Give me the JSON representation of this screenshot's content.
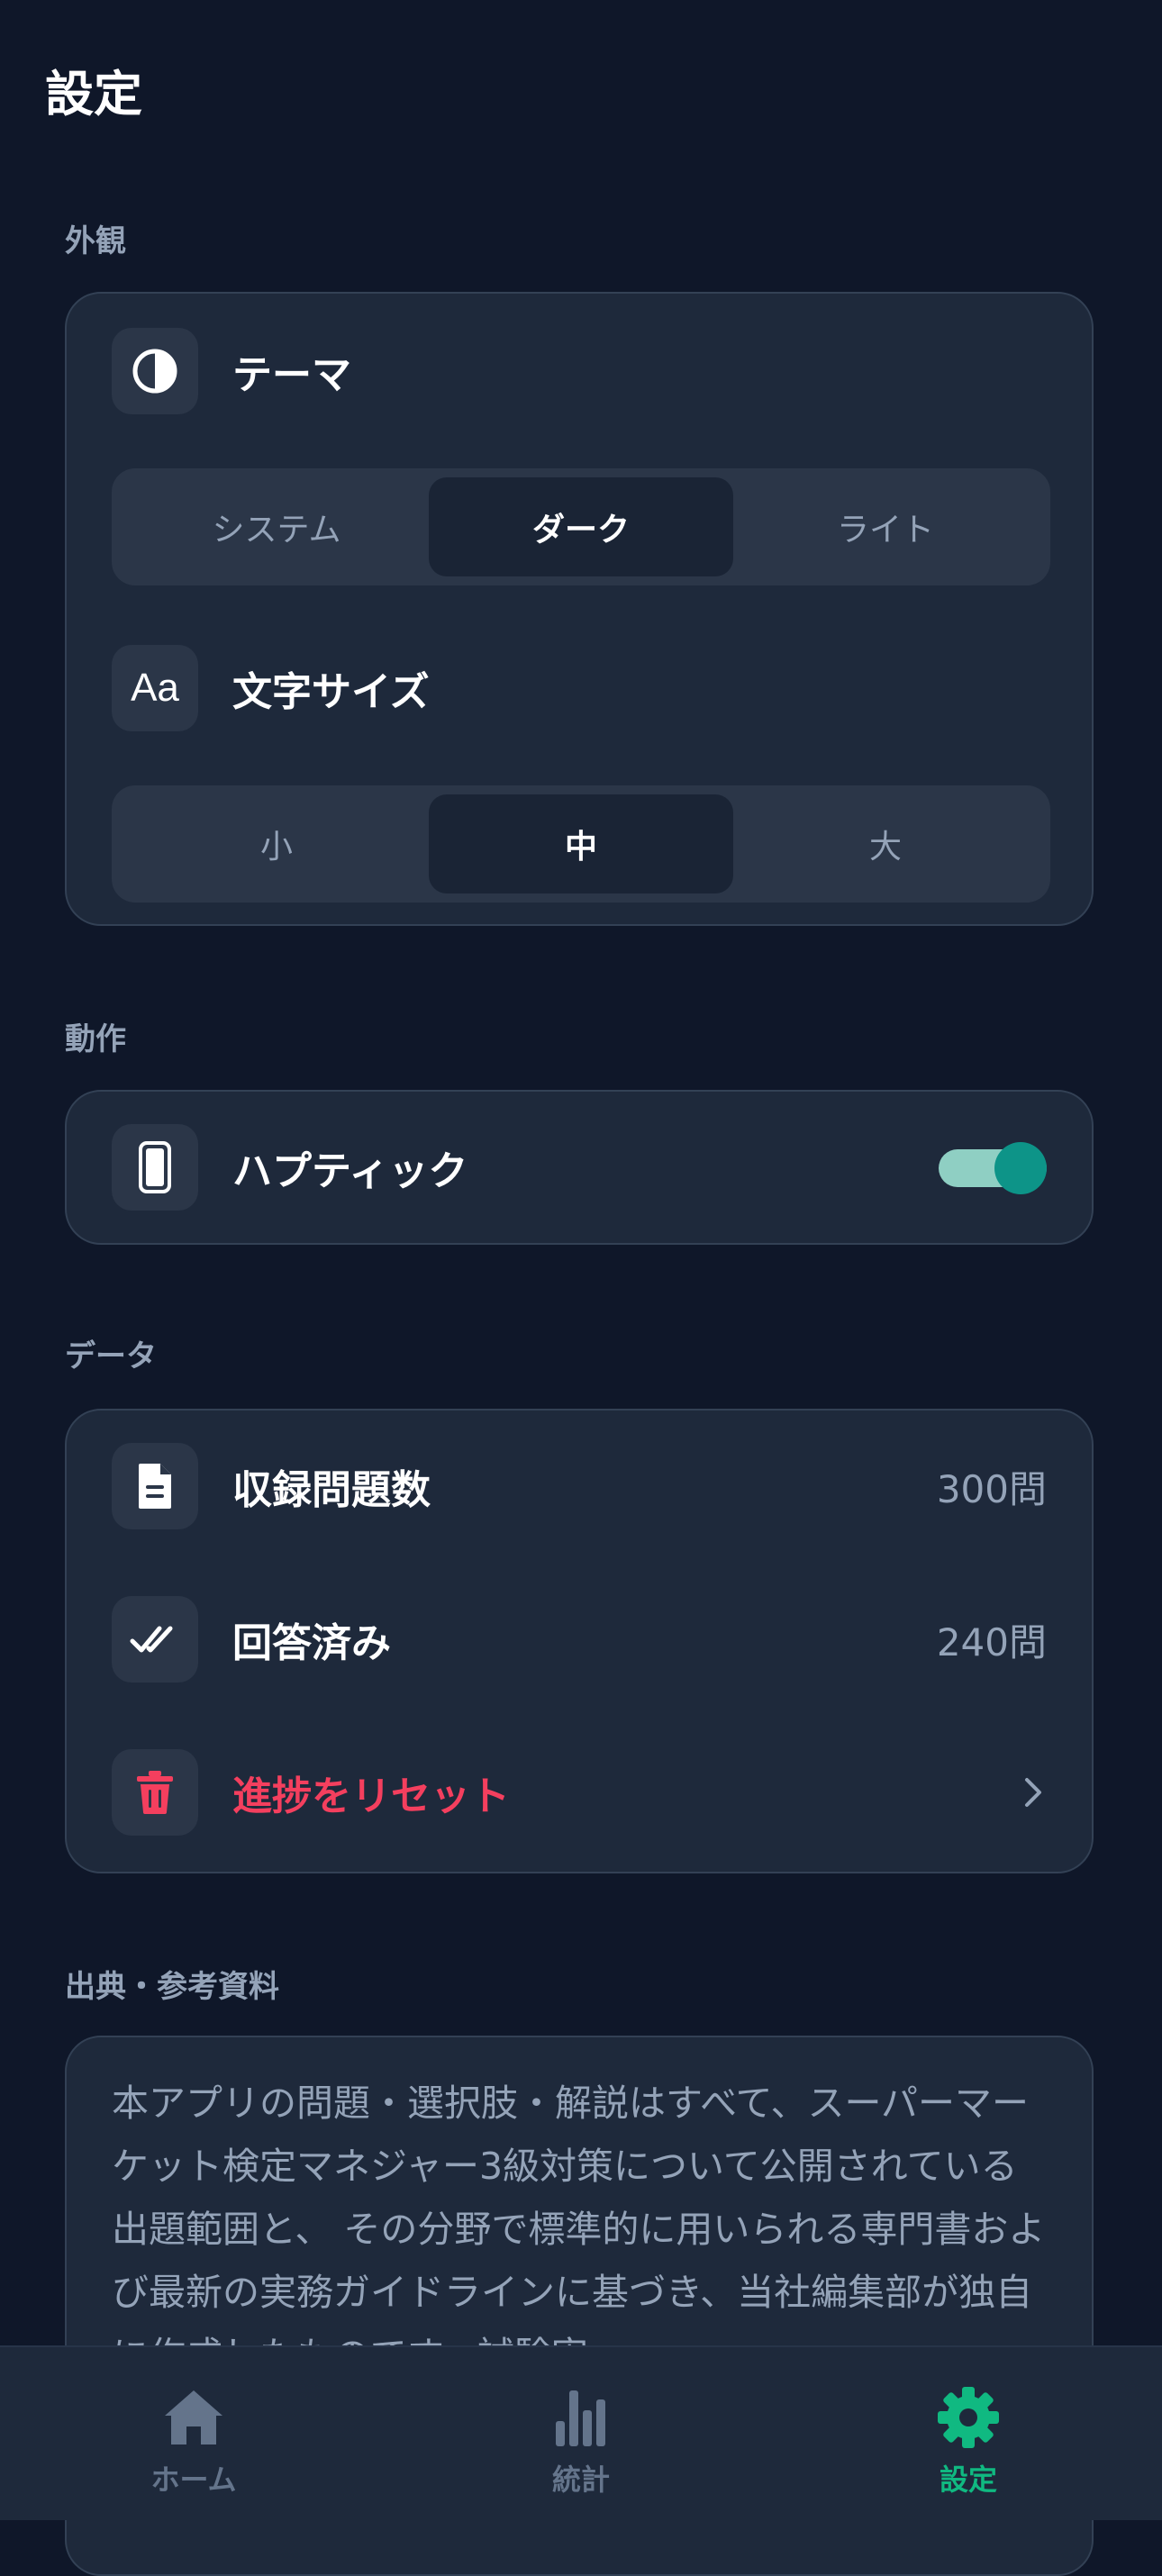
{
  "page": {
    "title": "設定"
  },
  "appearance": {
    "section_label": "外観",
    "theme": {
      "label": "テーマ",
      "options": [
        "システム",
        "ダーク",
        "ライト"
      ],
      "selected": "ダーク"
    },
    "text_size": {
      "label": "文字サイズ",
      "options": [
        "小",
        "中",
        "大"
      ],
      "selected": "中"
    }
  },
  "behavior": {
    "section_label": "動作",
    "haptics": {
      "label": "ハプティック",
      "enabled": true
    }
  },
  "data": {
    "section_label": "データ",
    "question_count": {
      "label": "収録問題数",
      "value": "300問"
    },
    "answered": {
      "label": "回答済み",
      "value": "240問"
    },
    "reset": {
      "label": "進捗をリセット"
    }
  },
  "sources": {
    "section_label": "出典・参考資料",
    "text": "本アプリの問題・選択肢・解説はすべて、スーパーマーケット検定マネジャー3級対策について公開されている出題範囲と、 その分野で標準的に用いられる専門書および最新の実務ガイドラインに基づき、当社編集部が独自に作成したものです。試験実"
  },
  "tabs": [
    {
      "label": "ホーム"
    },
    {
      "label": "統計"
    },
    {
      "label": "設定"
    }
  ],
  "colors": {
    "background": "#0f1729",
    "card": "#1e293b",
    "accent": "#10b981",
    "toggle_on": "#0d9488",
    "danger": "#f43f5e"
  }
}
